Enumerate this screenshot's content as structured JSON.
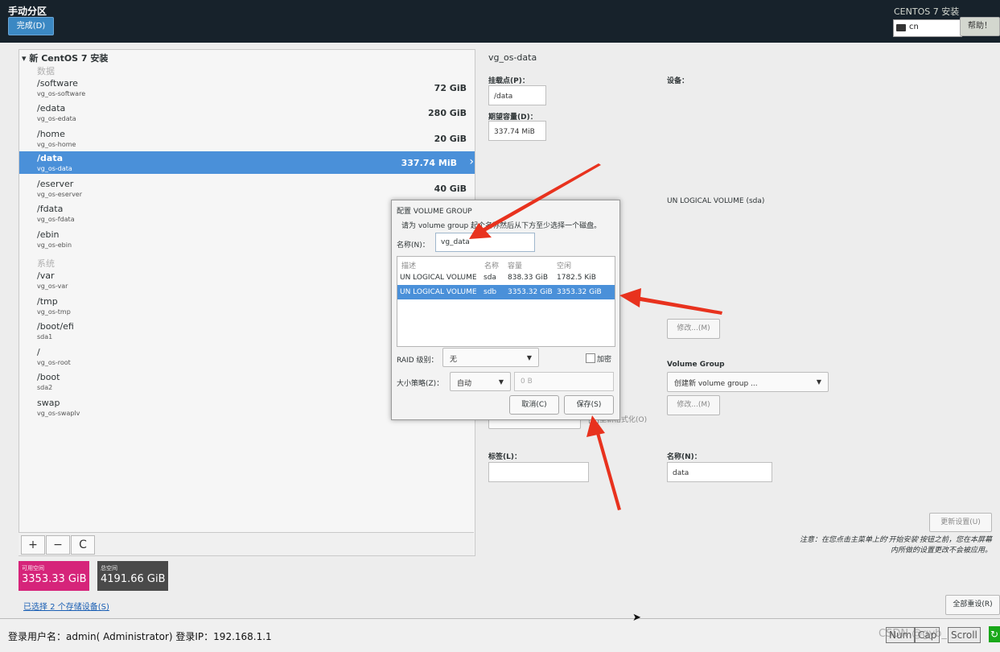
{
  "header": {
    "title": "手动分区",
    "done_button": "完成(D)",
    "install_title": "CENTOS 7 安装",
    "keyboard_layout": "cn",
    "help_button": "帮助！"
  },
  "tree": {
    "header": "新 CentOS 7 安装",
    "data_group_label": "数据",
    "system_group_label": "系统",
    "data_items": [
      {
        "mount": "/software",
        "device": "vg_os-software",
        "size": "72 GiB"
      },
      {
        "mount": "/edata",
        "device": "vg_os-edata",
        "size": "280 GiB"
      },
      {
        "mount": "/home",
        "device": "vg_os-home",
        "size": "20 GiB"
      },
      {
        "mount": "/data",
        "device": "vg_os-data",
        "size": "337.74 MiB"
      },
      {
        "mount": "/eserver",
        "device": "vg_os-eserver",
        "size": "40 GiB"
      },
      {
        "mount": "/fdata",
        "device": "vg_os-fdata",
        "size": ""
      },
      {
        "mount": "/ebin",
        "device": "vg_os-ebin",
        "size": ""
      }
    ],
    "system_items": [
      {
        "mount": "/var",
        "device": "vg_os-var"
      },
      {
        "mount": "/tmp",
        "device": "vg_os-tmp"
      },
      {
        "mount": "/boot/efi",
        "device": "sda1"
      },
      {
        "mount": "/",
        "device": "vg_os-root"
      },
      {
        "mount": "/boot",
        "device": "sda2"
      },
      {
        "mount": "swap",
        "device": "vg_os-swaplv"
      }
    ]
  },
  "toolbar": {
    "add": "+",
    "remove": "−",
    "refresh": "C"
  },
  "capacity": {
    "available_label": "可用空间",
    "available_value": "3353.33 GiB",
    "total_label": "总空间",
    "total_value": "4191.66 GiB"
  },
  "devices_link": "已选择 2 个存储设备(S)",
  "details": {
    "vg_title": "vg_os-data",
    "mount_point_label": "挂载点(P)：",
    "mount_point_value": "/data",
    "desired_capacity_label": "期望容量(D)：",
    "desired_capacity_value": "337.74 MiB",
    "device_label": "设备：",
    "device_value": "UN LOGICAL VOLUME (sda)",
    "modify_button": "修改...(M)",
    "volume_group_label": "Volume Group",
    "volume_group_value": "创建新 volume group ...",
    "modify_button2": "修改...(M)",
    "reformat_label": "重新格式化(O)",
    "tag_label": "标签(L)：",
    "name_label": "名称(N)：",
    "name_value": "data",
    "update_button": "更新设置(U)",
    "notice": "注意：在您点击主菜单上的'开始安装'按钮之前，您在本屏幕内所做的设置更改不会被应用。",
    "reset_button": "全部重设(R)"
  },
  "dialog": {
    "title": "配置 VOLUME GROUP",
    "description": "请为 volume group 起个名称然后从下方至少选择一个磁盘。",
    "name_label": "名称(N)：",
    "name_value": "vg_data",
    "columns": [
      "描述",
      "名称",
      "容量",
      "空闲"
    ],
    "rows": [
      {
        "desc": "UN LOGICAL VOLUME",
        "name": "sda",
        "capacity": "838.33 GiB",
        "free": "1782.5 KiB",
        "selected": false
      },
      {
        "desc": "UN LOGICAL VOLUME",
        "name": "sdb",
        "capacity": "3353.32 GiB",
        "free": "3353.32 GiB",
        "selected": true
      }
    ],
    "raid_label": "RAID 级别：",
    "raid_value": "无",
    "encrypt_label": "加密",
    "size_policy_label": "大小策略(Z)：",
    "size_policy_value": "自动",
    "size_value": "0 B",
    "cancel_button": "取消(C)",
    "save_button": "保存(S)"
  },
  "statusbar": {
    "login_text": "登录用户名：admin( Administrator)   登录IP：192.168.1.1",
    "num_key": "Num",
    "caps_key": "Cap",
    "scroll_key": "Scroll",
    "watermark": "CSDN @gyb_"
  },
  "colors": {
    "header_bg": "#17222b",
    "selection": "#4a90d9",
    "available_bg": "#d6247a",
    "total_bg": "#4a4a4a",
    "arrow": "#e8321e"
  }
}
